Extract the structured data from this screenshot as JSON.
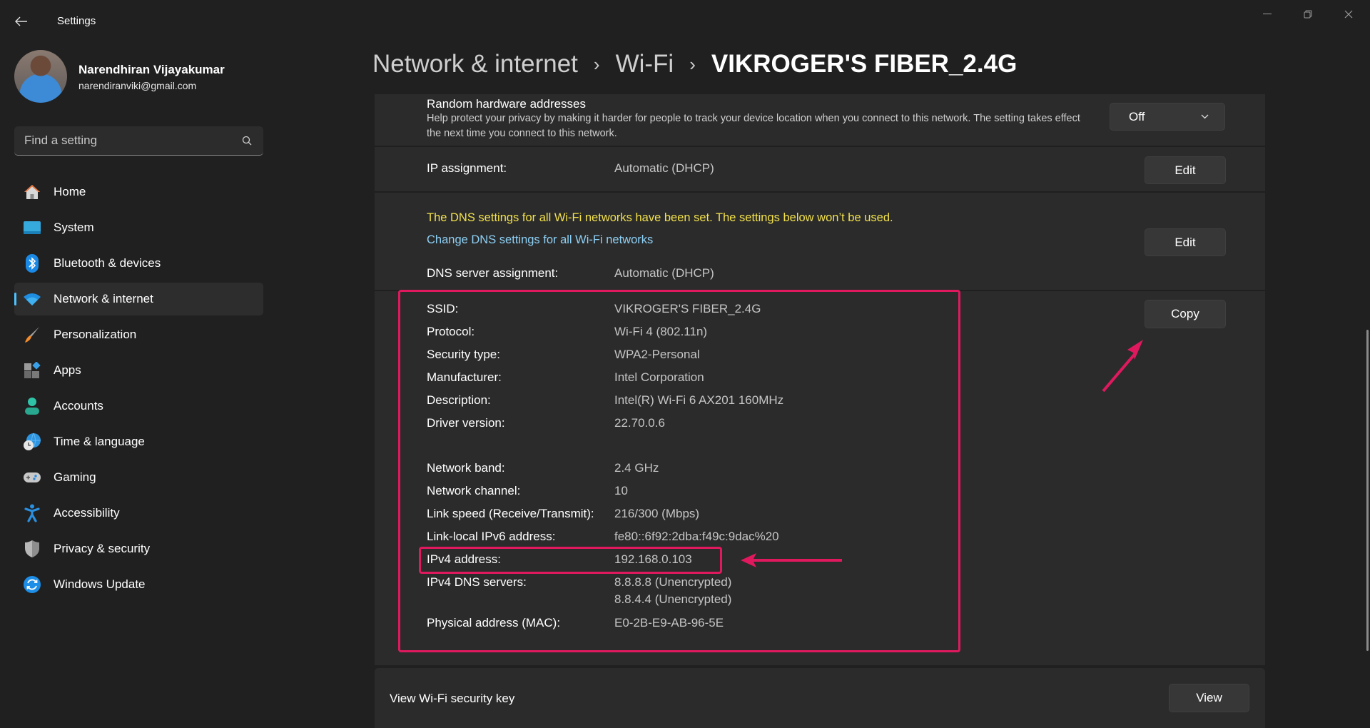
{
  "window": {
    "title": "Settings",
    "controls": {
      "minimize": "minimize-icon",
      "restore": "restore-icon",
      "close": "close-icon"
    }
  },
  "profile": {
    "name": "Narendhiran Vijayakumar",
    "email": "narendiranviki@gmail.com"
  },
  "search": {
    "placeholder": "Find a setting",
    "value": ""
  },
  "sidebar": {
    "items": [
      {
        "label": "Home",
        "icon": "home-icon"
      },
      {
        "label": "System",
        "icon": "system-icon"
      },
      {
        "label": "Bluetooth & devices",
        "icon": "bluetooth-icon"
      },
      {
        "label": "Network & internet",
        "icon": "wifi-icon",
        "selected": true
      },
      {
        "label": "Personalization",
        "icon": "brush-icon"
      },
      {
        "label": "Apps",
        "icon": "apps-icon"
      },
      {
        "label": "Accounts",
        "icon": "person-icon"
      },
      {
        "label": "Time & language",
        "icon": "globe-clock-icon"
      },
      {
        "label": "Gaming",
        "icon": "gamepad-icon"
      },
      {
        "label": "Accessibility",
        "icon": "accessibility-icon"
      },
      {
        "label": "Privacy & security",
        "icon": "shield-icon"
      },
      {
        "label": "Windows Update",
        "icon": "update-icon"
      }
    ]
  },
  "breadcrumb": [
    "Network & internet",
    "Wi-Fi",
    "VIKROGER'S FIBER_2.4G"
  ],
  "random_hw": {
    "title": "Random hardware addresses",
    "description": "Help protect your privacy by making it harder for people to track your device location when you connect to this network. The setting takes effect the next time you connect to this network.",
    "value": "Off"
  },
  "ip_assignment": {
    "label": "IP assignment:",
    "value": "Automatic (DHCP)",
    "button": "Edit"
  },
  "dns": {
    "warning": "The DNS settings for all Wi-Fi networks have been set. The settings below won’t be used.",
    "link": "Change DNS settings for all Wi-Fi networks",
    "label": "DNS server assignment:",
    "value": "Automatic (DHCP)",
    "button": "Edit"
  },
  "properties": {
    "copy_button": "Copy",
    "rows": [
      {
        "label": "SSID:",
        "value": "VIKROGER'S FIBER_2.4G"
      },
      {
        "label": "Protocol:",
        "value": "Wi-Fi 4 (802.11n)"
      },
      {
        "label": "Security type:",
        "value": "WPA2-Personal"
      },
      {
        "label": "Manufacturer:",
        "value": "Intel Corporation"
      },
      {
        "label": "Description:",
        "value": "Intel(R) Wi-Fi 6 AX201 160MHz"
      },
      {
        "label": "Driver version:",
        "value": "22.70.0.6"
      },
      {
        "label": "Network band:",
        "value": "2.4 GHz"
      },
      {
        "label": "Network channel:",
        "value": "10"
      },
      {
        "label": "Link speed (Receive/Transmit):",
        "value": "216/300 (Mbps)"
      },
      {
        "label": "Link-local IPv6 address:",
        "value": "fe80::6f92:2dba:f49c:9dac%20"
      },
      {
        "label": "IPv4 address:",
        "value": "192.168.0.103"
      },
      {
        "label": "IPv4 DNS servers:",
        "value": "8.8.8.8 (Unencrypted)",
        "value2": "8.8.4.4 (Unencrypted)"
      },
      {
        "label": "Physical address (MAC):",
        "value": "E0-2B-E9-AB-96-5E"
      }
    ]
  },
  "security_key": {
    "label": "View Wi-Fi security key",
    "button": "View"
  },
  "colors": {
    "accent": "#4cc2ff",
    "annotation": "#e0195f",
    "warning_text": "#f2e14c",
    "link_text": "#8ed0f5",
    "background": "#202020",
    "card": "#2b2b2b"
  }
}
